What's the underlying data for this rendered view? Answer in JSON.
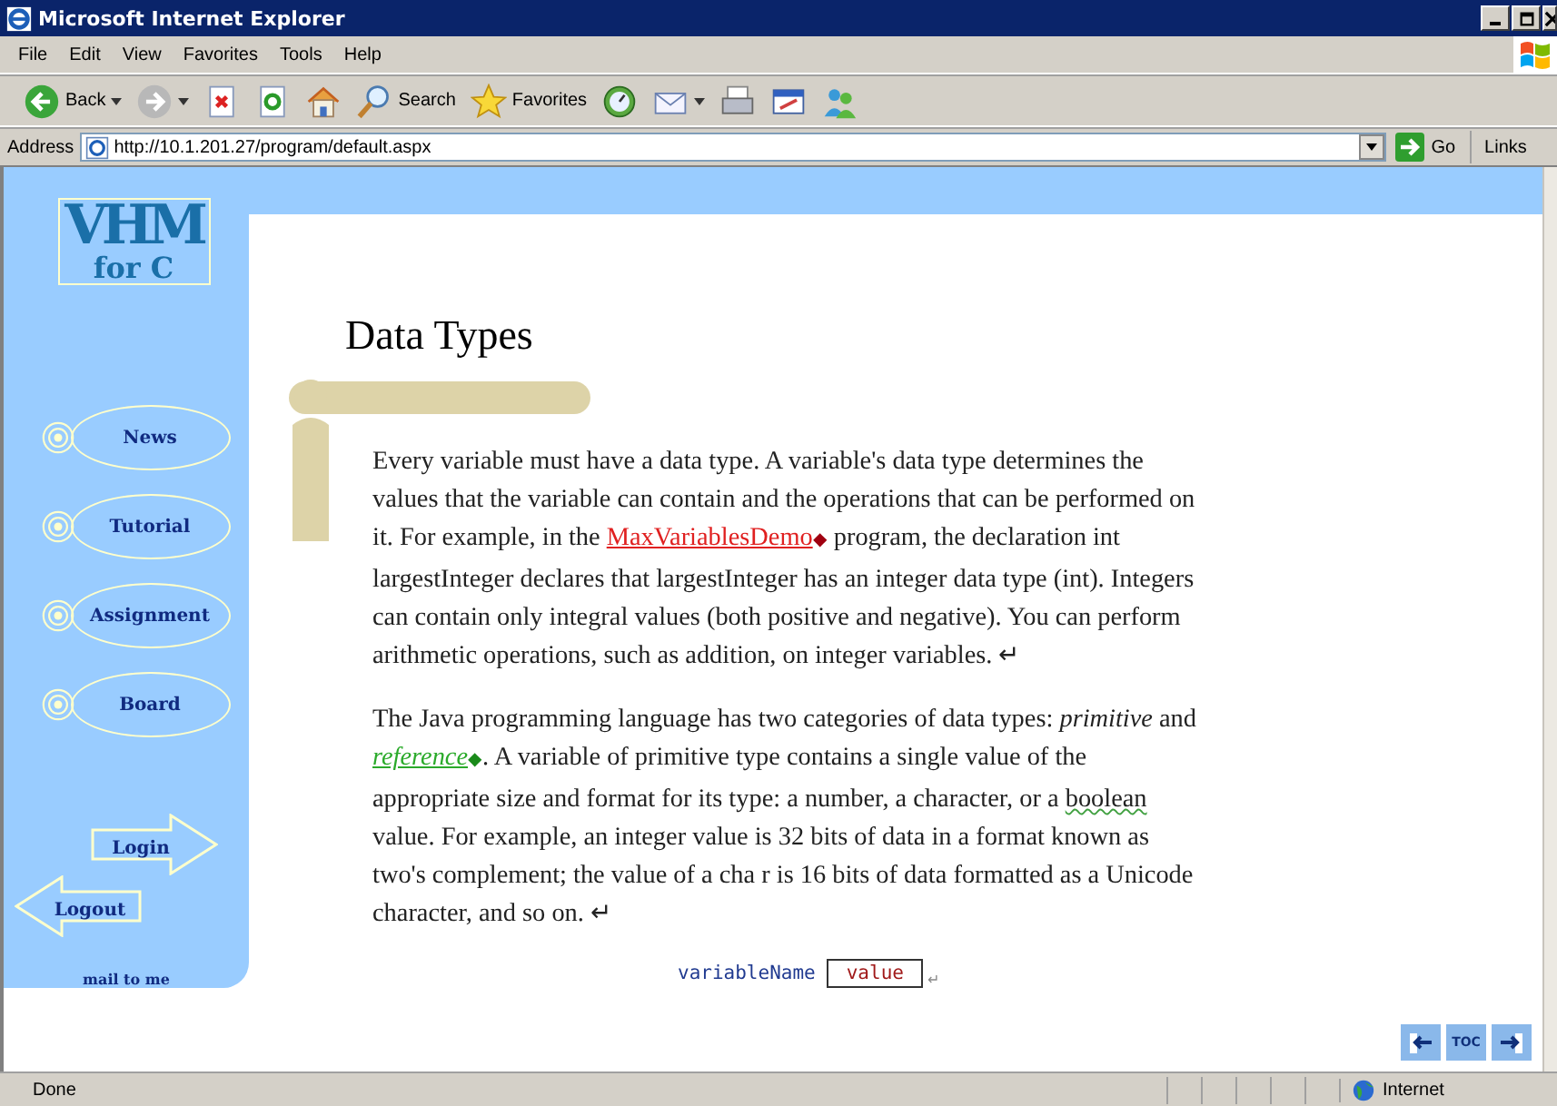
{
  "window": {
    "title": "Microsoft Internet Explorer"
  },
  "menu": [
    "File",
    "Edit",
    "View",
    "Favorites",
    "Tools",
    "Help"
  ],
  "toolbar": [
    {
      "kind": "back",
      "label": "Back",
      "dropdown": true
    },
    {
      "kind": "forward",
      "dropdown": true
    },
    {
      "kind": "stop"
    },
    {
      "kind": "refresh"
    },
    {
      "kind": "home"
    },
    {
      "kind": "search",
      "label": "Search"
    },
    {
      "kind": "favorites",
      "label": "Favorites"
    },
    {
      "kind": "history"
    },
    {
      "kind": "mail",
      "dropdown": true
    },
    {
      "kind": "print"
    },
    {
      "kind": "edit"
    },
    {
      "kind": "messenger"
    }
  ],
  "address": {
    "label": "Address",
    "value": "http://10.1.201.27/program/default.aspx",
    "go": "Go",
    "links": "Links"
  },
  "sidebar": {
    "logo": [
      "VHM",
      "for C"
    ],
    "nav": [
      "News",
      "Tutorial",
      "Assignment",
      "Board"
    ],
    "login": "Login",
    "logout": "Logout",
    "mail": "mail to me"
  },
  "page": {
    "heading": "Data Types",
    "paragraphs": [
      [
        {
          "kind": "text",
          "text": "Every variable must have a data type. A variable's data type determines the values that the variable can contain and the operations that can be performed on it. For example, in the "
        },
        {
          "kind": "link",
          "text": "MaxVariablesDemo",
          "mark": "◆"
        },
        {
          "kind": "text",
          "text": " program, the declaration int largestInteger declares that largestInteger has an integer data type (int). Integers can contain only integral values (both positive and negative). You can perform arithmetic operations, such as addition, on integer variables. ↵"
        }
      ],
      [
        {
          "kind": "text",
          "text": "The Java programming language has two categories of data types: "
        },
        {
          "kind": "italic",
          "text": "primitive"
        },
        {
          "kind": "text",
          "text": " and "
        },
        {
          "kind": "glossary",
          "text": "reference",
          "mark": "◆"
        },
        {
          "kind": "text",
          "text": ". A variable of primitive type contains a single value of the appropriate size and format for its type: a number, a character, or a "
        },
        {
          "kind": "spell",
          "text": "boolean"
        },
        {
          "kind": "text",
          "text": " value. For example, an integer value is 32 bits of data in a format known as two's complement; the value of a cha r is 16 bits of data formatted as a Unicode character, and so on. ↵"
        }
      ]
    ],
    "code": {
      "name": "variableName",
      "value": "value",
      "mark": "↵"
    },
    "nav": [
      {
        "kind": "prev"
      },
      {
        "kind": "toc",
        "label": "TOC"
      },
      {
        "kind": "next"
      }
    ]
  },
  "status": {
    "text": "Done",
    "zone": "Internet"
  }
}
